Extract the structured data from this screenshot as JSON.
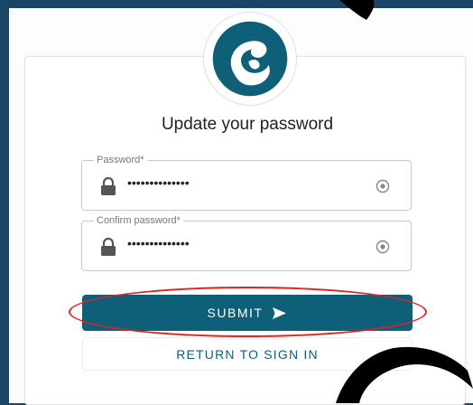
{
  "page": {
    "title": "Update your password"
  },
  "form": {
    "password": {
      "label": "Password*",
      "value": "••••••••••••••"
    },
    "confirm_password": {
      "label": "Confirm password*",
      "value": "••••••••••••••"
    }
  },
  "actions": {
    "submit_label": "SUBMIT",
    "return_label": "RETURN TO SIGN IN"
  },
  "icons": {
    "logo": "brand-logo-icon",
    "lock": "lock-icon",
    "reveal": "eye-icon",
    "send": "send-icon"
  },
  "colors": {
    "brand": "#0e5f78",
    "background": "#1a4566",
    "highlight": "#e32222"
  }
}
